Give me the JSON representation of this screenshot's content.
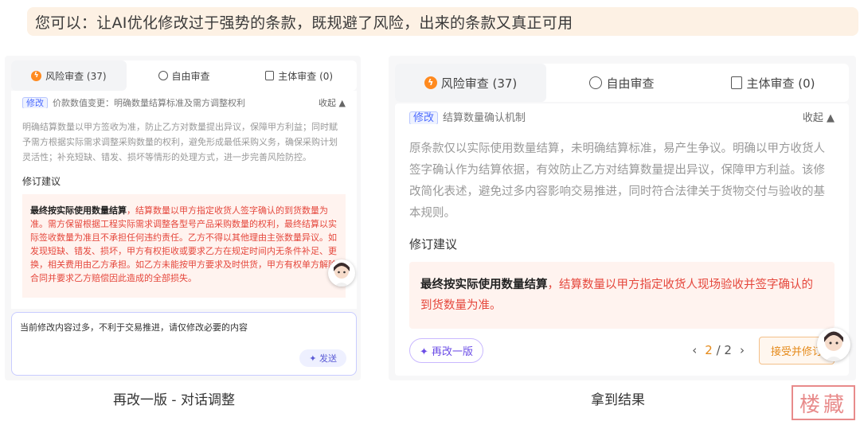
{
  "banner": "您可以：让AI优化修改过于强势的条款，既规避了风险，出来的条款又真正可用",
  "left": {
    "tabs": [
      {
        "label": "风险审查 (37)",
        "icon": "flash-icon"
      },
      {
        "label": "自由审查",
        "icon": "chat-icon"
      },
      {
        "label": "主体审查 (0)",
        "icon": "doc-icon"
      }
    ],
    "item_tag": "修改",
    "item_title": "价款数值变更：明确数量结算标准及需方调整权利",
    "collapse": "收起 ▲",
    "desc": "明确结算数量以甲方签收为准，防止乙方对数量提出异议，保障甲方利益；同时赋予需方根据实际需求调整采购数量的权利，避免形成最低采购义务，确保采购计划灵活性；补充短缺、错发、损坏等情形的处理方式，进一步完善风险防控。",
    "section": "修订建议",
    "suggest_bold": "最终按实际使用数量结算",
    "suggest_text": "，结算数量以甲方指定收货人签字确认的到货数量为准。需方保留根据工程实际需求调整各型号产品采购数量的权利，最终结算以实际签收数量为准且不承担任何违约责任。乙方不得以其他理由主张数量异议。如发现短缺、错发、损坏，甲方有权拒收或要求乙方在规定时间内无条件补足、更换，相关费用由乙方承担。如乙方未能按甲方要求及时供货，甲方有权单方解除合同并要求乙方赔偿因此造成的全部损失。",
    "input_text": "当前修改内容过多，不利于交易推进，请仅修改必要的内容",
    "send": "✦ 发送",
    "caption": "再改一版 - 对话调整"
  },
  "right": {
    "tabs": [
      {
        "label": "风险审查 (37)",
        "icon": "flash-icon"
      },
      {
        "label": "自由审查",
        "icon": "chat-icon"
      },
      {
        "label": "主体审查 (0)",
        "icon": "doc-icon"
      }
    ],
    "item_tag": "修改",
    "item_title": "结算数量确认机制",
    "collapse": "收起 ▲",
    "desc": "原条款仅以实际使用数量结算，未明确结算标准，易产生争议。明确以甲方收货人签字确认作为结算依据，有效防止乙方对结算数量提出异议，保障甲方利益。该修改简化表述，避免过多内容影响交易推进，同时符合法律关于货物交付与验收的基本规则。",
    "section": "修订建议",
    "suggest_bold": "最终按实际使用数量结算",
    "suggest_text": "，结算数量以甲方指定收货人现场验收并签字确认的到货数量为准。",
    "redo": "✦ 再改一版",
    "pager_prev": "‹",
    "pager_cur": "2",
    "pager_total": "/ 2",
    "pager_next": "›",
    "accept": "接受并修订",
    "caption": "拿到结果"
  },
  "stamp": "楼藏",
  "colors": {
    "accent": "#ff8a1f",
    "danger": "#e5473c",
    "purple": "#6b4ce6"
  }
}
